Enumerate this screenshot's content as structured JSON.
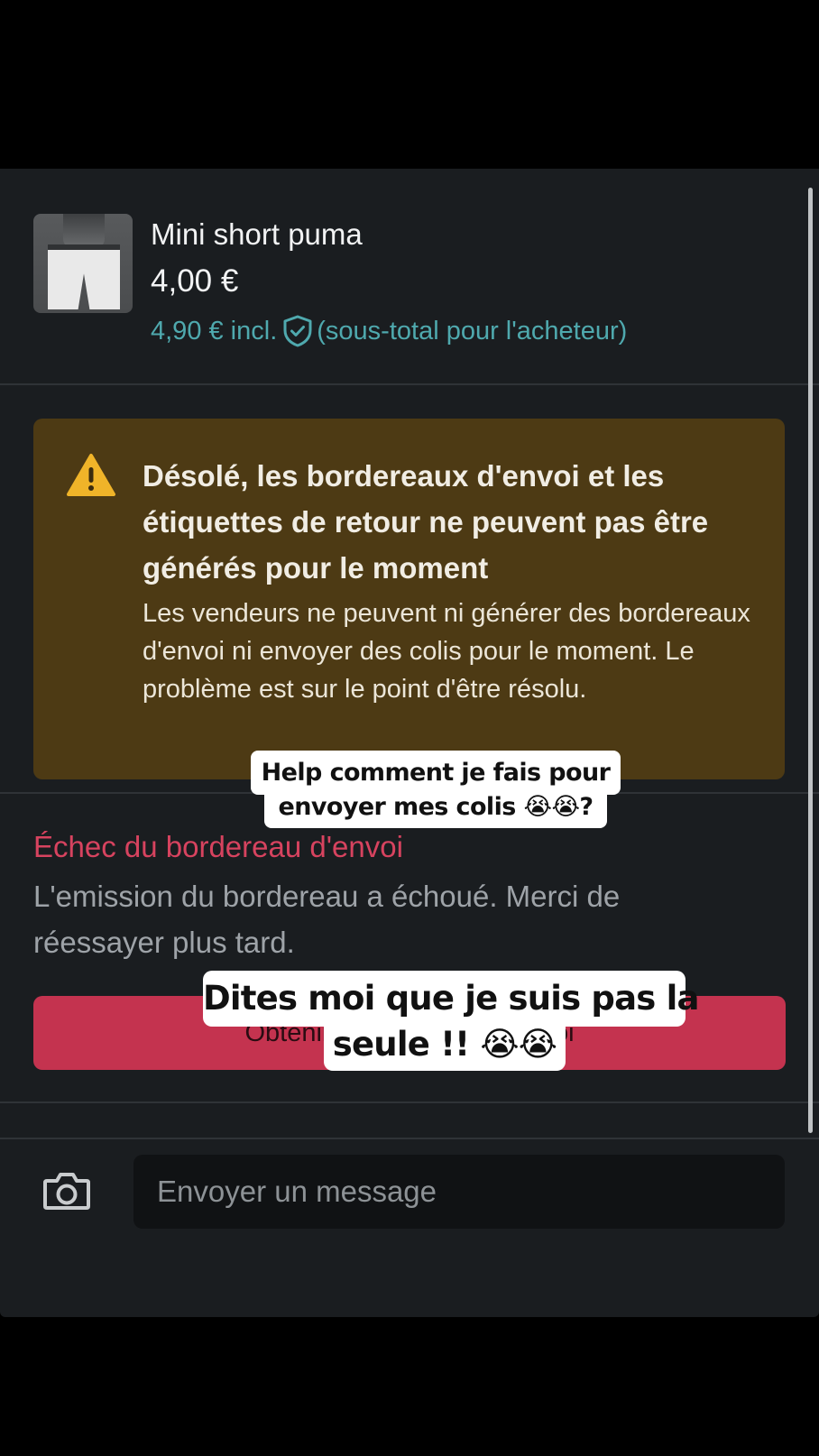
{
  "product": {
    "title": "Mini short puma",
    "price": "4,00 €",
    "total_price": "4,90 € incl.",
    "total_note": "(sous-total pour l'acheteur)",
    "total_icon": "shield-check-icon"
  },
  "warning": {
    "icon": "warning-triangle-icon",
    "title": "Désolé, les bordereaux d'envoi et les étiquettes de retour ne peuvent pas être générés pour le moment",
    "body": "Les vendeurs ne peuvent ni générer des bordereaux d'envoi ni envoyer des colis pour le moment. Le problème est sur le point d'être résolu."
  },
  "error": {
    "title": "Échec du bordereau d'envoi",
    "body": "L'emission du bordereau a échoué. Merci de réessayer plus tard."
  },
  "cta": {
    "label": "Obtenir le bordereau d'envoi"
  },
  "composer": {
    "camera_icon": "camera-icon",
    "placeholder": "Envoyer un message"
  },
  "captions": {
    "first_line1": "Help comment je fais pour",
    "first_line2": "envoyer mes colis 😭😭?",
    "second_line1": "Dites moi que je suis pas la",
    "second_line2": "seule !! 😭😭"
  },
  "colors": {
    "background": "#1a1d20",
    "accent_teal": "#4fa9ae",
    "warning_bg": "#4d3a14",
    "warning_icon": "#f0b429",
    "error_red": "#d7435f",
    "button_red": "#c4334f"
  }
}
